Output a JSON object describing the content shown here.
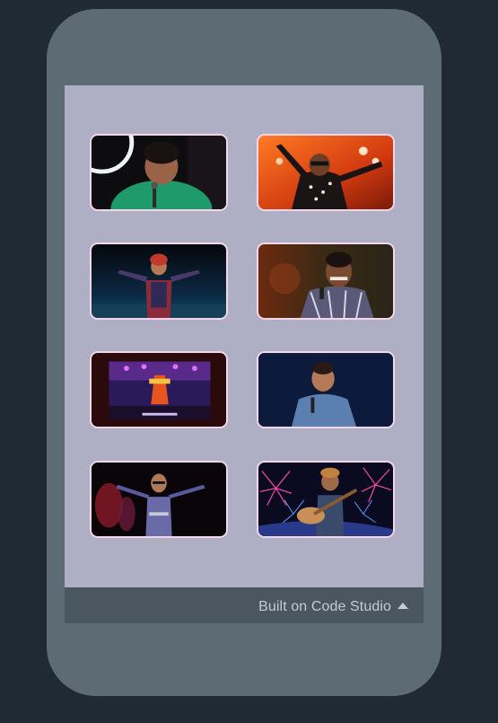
{
  "footer": {
    "label": "Built on Code Studio",
    "icon": "caret-up-icon"
  },
  "gallery": {
    "items": [
      {
        "name": "performer-1",
        "alt": "Comedian with microphone in green shirt"
      },
      {
        "name": "performer-2",
        "alt": "Singer with raised arms on red-lit stage"
      },
      {
        "name": "performer-3",
        "alt": "Performer in turban with arms outstretched"
      },
      {
        "name": "performer-4",
        "alt": "Smiling comedian in plaid shirt"
      },
      {
        "name": "performer-5",
        "alt": "Festival stage with banner"
      },
      {
        "name": "performer-6",
        "alt": "Comedian in denim shirt with microphone"
      },
      {
        "name": "performer-7",
        "alt": "Performer with dancers and arms outstretched"
      },
      {
        "name": "performer-8",
        "alt": "Guitarist in front of fireworks"
      }
    ]
  },
  "colors": {
    "page_bg": "#1f2a33",
    "phone_frame": "#5d6b74",
    "screen_bg": "#aeafc4",
    "tile_border": "#f3d6e7",
    "footer_bg": "#4a575f",
    "footer_text": "#c4cbd0"
  }
}
